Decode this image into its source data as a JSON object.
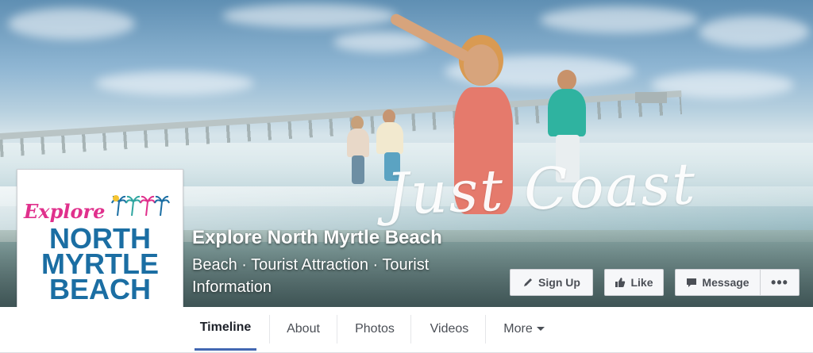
{
  "cover": {
    "tagline": "Just Coast"
  },
  "profile": {
    "logo_script": "Explore",
    "logo_line1": "NORTH",
    "logo_line2": "MYRTLE",
    "logo_line3": "BEACH"
  },
  "page": {
    "name": "Explore North Myrtle Beach",
    "category": "Beach · Tourist Attraction · Tourist Information"
  },
  "actions": {
    "signup_label": "Sign Up",
    "like_label": "Like",
    "message_label": "Message",
    "more_label": "•••"
  },
  "tabs": [
    {
      "label": "Timeline"
    },
    {
      "label": "About"
    },
    {
      "label": "Photos"
    },
    {
      "label": "Videos"
    },
    {
      "label": "More"
    }
  ],
  "colors": {
    "brand_pink": "#e0308c",
    "brand_blue": "#1b6ea3",
    "facebook_blue": "#4267b2"
  }
}
